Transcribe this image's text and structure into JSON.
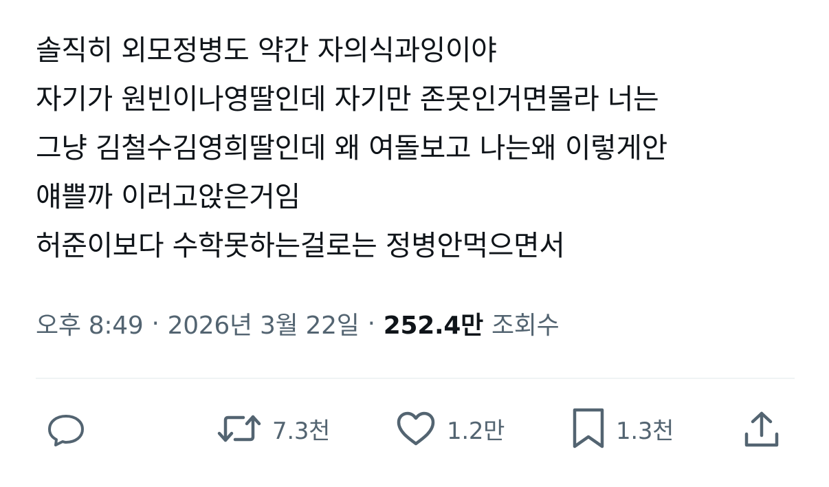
{
  "tweet": {
    "lines": [
      "솔직히 외모정병도 약간 자의식과잉이야",
      "자기가 원빈이나영딸인데 자기만 존못인거면몰라 너는",
      "그냥 김철수김영희딸인데 왜 여돌보고 나는왜 이렇게안",
      "얘쁠까 이러고앉은거임",
      "허준이보다 수학못하는걸로는 정병안먹으면서"
    ]
  },
  "meta": {
    "time": "오후 8:49",
    "separator": "·",
    "date": "2026년 3월 22일",
    "views_count": "252.4만",
    "views_label": "조회수"
  },
  "actions": {
    "reply": {
      "icon": "reply-icon"
    },
    "retweet": {
      "icon": "retweet-icon",
      "count": "7.3천"
    },
    "like": {
      "icon": "heart-icon",
      "count": "1.2만"
    },
    "bookmark": {
      "icon": "bookmark-icon",
      "count": "1.3천"
    },
    "share": {
      "icon": "share-icon"
    }
  },
  "colors": {
    "text": "#0f1419",
    "secondary": "#536471",
    "divider": "#eff3f4"
  }
}
